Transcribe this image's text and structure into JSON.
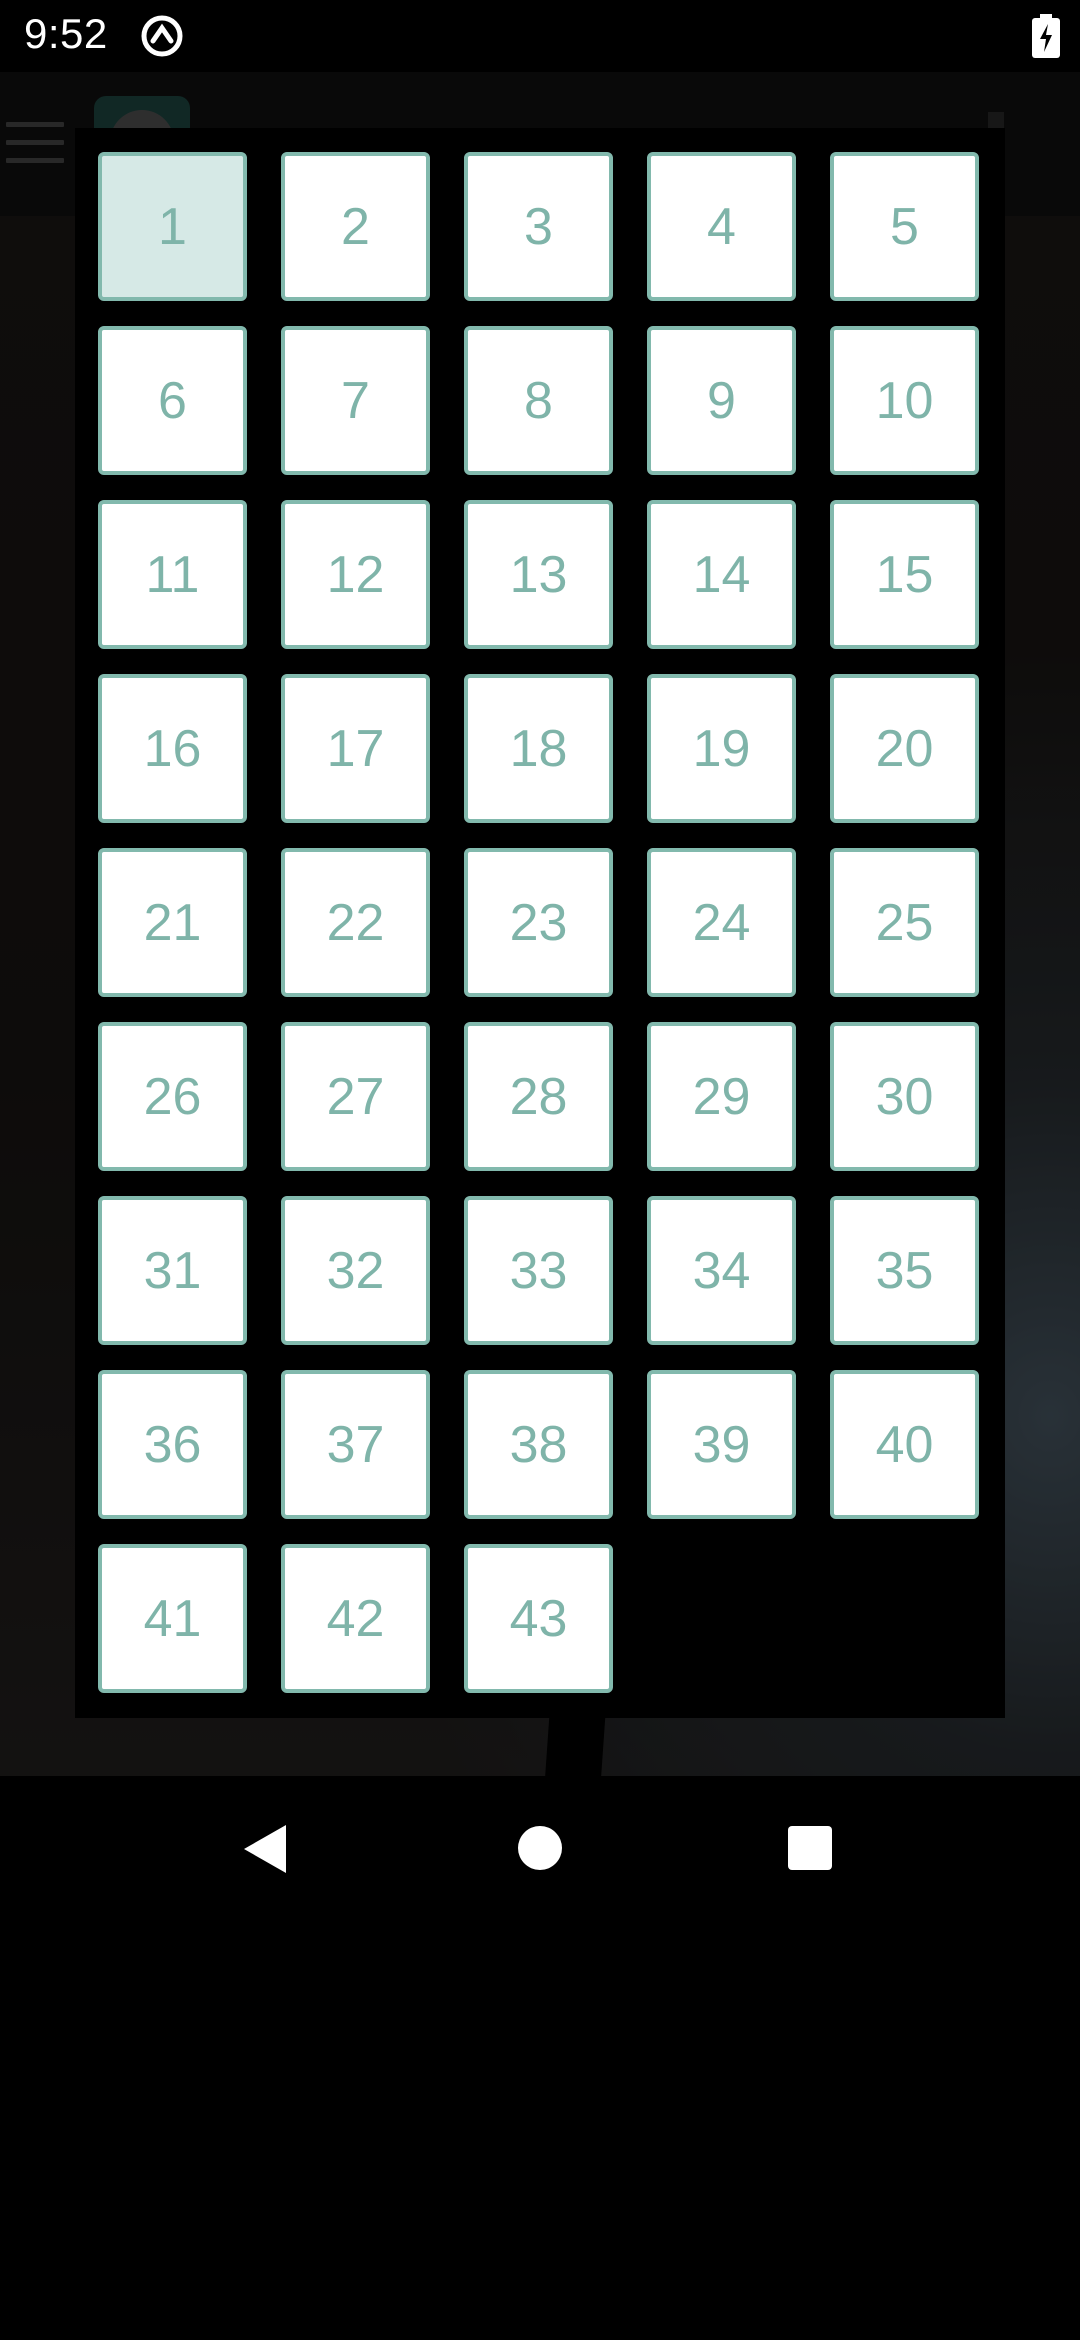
{
  "status_bar": {
    "time": "9:52",
    "icons": [
      "app-notification-icon",
      "battery-charging-icon"
    ]
  },
  "app": {
    "toolbar_icons": [
      "hamburger-menu-icon",
      "app-avatar"
    ]
  },
  "chapter_dialog": {
    "selected": "1",
    "chapters": [
      "1",
      "2",
      "3",
      "4",
      "5",
      "6",
      "7",
      "8",
      "9",
      "10",
      "11",
      "12",
      "13",
      "14",
      "15",
      "16",
      "17",
      "18",
      "19",
      "20",
      "21",
      "22",
      "23",
      "24",
      "25",
      "26",
      "27",
      "28",
      "29",
      "30",
      "31",
      "32",
      "33",
      "34",
      "35",
      "36",
      "37",
      "38",
      "39",
      "40",
      "41",
      "42",
      "43"
    ]
  },
  "colors": {
    "cell_border": "#82b9ad",
    "cell_text": "#7fb4a9",
    "cell_selected_bg": "#d6e9e6",
    "cell_bg": "#ffffff",
    "dialog_bg": "#000000"
  },
  "nav_bar": {
    "buttons": [
      "back-icon",
      "home-icon",
      "recents-icon"
    ]
  }
}
